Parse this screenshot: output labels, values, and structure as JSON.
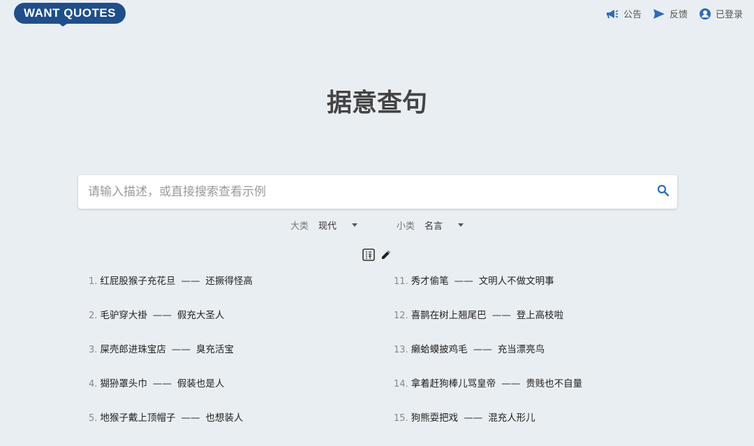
{
  "logo": {
    "text": "WANT QUOTES"
  },
  "nav": {
    "announce": "公告",
    "feedback": "反馈",
    "account": "已登录"
  },
  "page": {
    "title": "据意查句"
  },
  "search": {
    "placeholder": "请输入描述，或直接搜索查看示例",
    "value": ""
  },
  "filters": {
    "major": {
      "label": "大类",
      "value": "现代"
    },
    "minor": {
      "label": "小类",
      "value": "名言"
    }
  },
  "quotes_left": [
    {
      "num": "1.",
      "front": "红屁股猴子充花旦",
      "dash": "——",
      "back": "还撅得怪高"
    },
    {
      "num": "2.",
      "front": "毛驴穿大褂",
      "dash": "——",
      "back": "假充大圣人"
    },
    {
      "num": "3.",
      "front": "屎壳郎进珠宝店",
      "dash": "——",
      "back": "臭充活宝"
    },
    {
      "num": "4.",
      "front": "猢狲罩头巾",
      "dash": "——",
      "back": "假装也是人"
    },
    {
      "num": "5.",
      "front": "地猴子戴上顶帽子",
      "dash": "——",
      "back": "也想装人"
    }
  ],
  "quotes_right": [
    {
      "num": "11.",
      "front": "秀才偷笔",
      "dash": "——",
      "back": "文明人不做文明事"
    },
    {
      "num": "12.",
      "front": "喜鹊在树上翘尾巴",
      "dash": "——",
      "back": "登上高枝啦"
    },
    {
      "num": "13.",
      "front": "癞蛤蟆披鸡毛",
      "dash": "——",
      "back": "充当漂亮鸟"
    },
    {
      "num": "14.",
      "front": "拿着赶狗棒儿骂皇帝",
      "dash": "——",
      "back": "贵贱也不自量"
    },
    {
      "num": "15.",
      "front": "狗熊耍把戏",
      "dash": "——",
      "back": "混充人形儿"
    }
  ],
  "colors": {
    "brand": "#1e4e8c",
    "accent": "#2a6bc0",
    "background": "#e9eef2"
  }
}
